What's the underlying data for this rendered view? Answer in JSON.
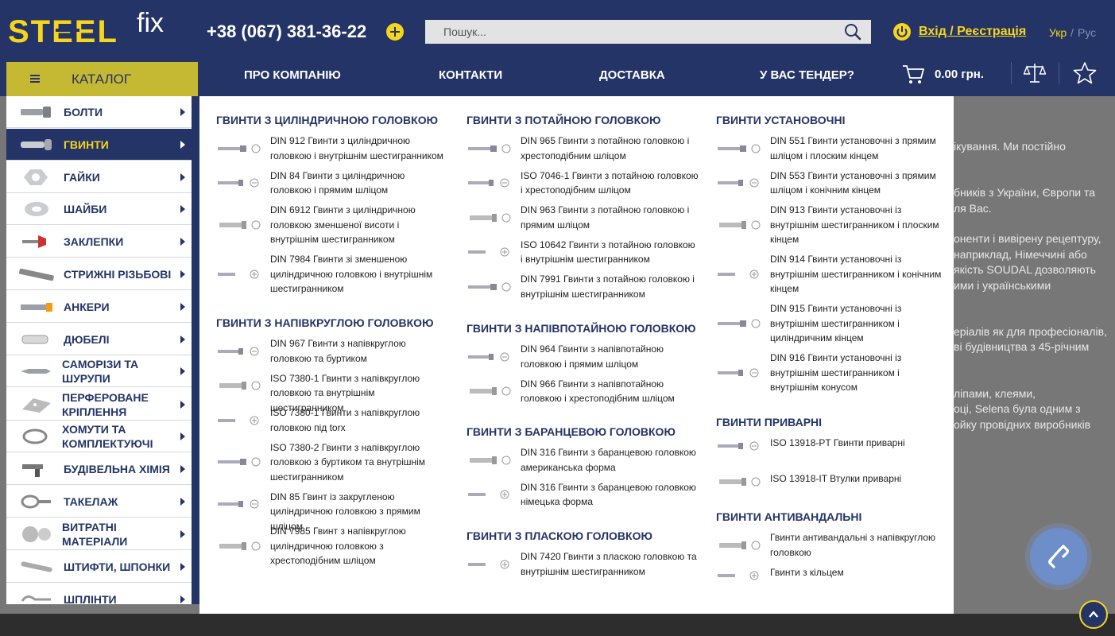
{
  "header": {
    "logo_text": "STEEL",
    "logo_suffix": "fix",
    "phone": "+38 (067) 381-36-22",
    "search_placeholder": "Пошук...",
    "login": "Вхід / Реєстрація",
    "lang_ua": "Укр",
    "lang_sep": "/",
    "lang_ru": "Рус"
  },
  "nav": {
    "catalog": "КАТАЛОГ",
    "items": [
      "ПРО КОМПАНІЮ",
      "КОНТАКТИ",
      "ДОСТАВКА",
      "У ВАС ТЕНДЕР?"
    ],
    "cart_total": "0.00 грн."
  },
  "sidebar": {
    "items": [
      {
        "label": "БОЛТИ",
        "icon": "bolt-icon"
      },
      {
        "label": "ГВИНТИ",
        "icon": "screw-icon",
        "active": true
      },
      {
        "label": "ГАЙКИ",
        "icon": "nut-icon"
      },
      {
        "label": "ШАЙБИ",
        "icon": "washer-icon"
      },
      {
        "label": "ЗАКЛЕПКИ",
        "icon": "rivet-icon"
      },
      {
        "label": "СТРИЖНІ РІЗЬБОВІ",
        "icon": "threaded-rod-icon"
      },
      {
        "label": "АНКЕРИ",
        "icon": "anchor-icon"
      },
      {
        "label": "ДЮБЕЛІ",
        "icon": "dowel-icon"
      },
      {
        "label": "САМОРІЗИ ТА\nШУРУПИ",
        "icon": "self-tapping-screw-icon"
      },
      {
        "label": "ПЕРФЕРОВАНЕ\nКРІПЛЕННЯ",
        "icon": "perforated-fastener-icon"
      },
      {
        "label": "ХОМУТИ ТА\nКОМПЛЕКТУЮЧІ",
        "icon": "clamp-icon"
      },
      {
        "label": "БУДІВЕЛЬНА ХІМІЯ",
        "icon": "sealant-gun-icon"
      },
      {
        "label": "ТАКЕЛАЖ",
        "icon": "rigging-icon"
      },
      {
        "label": "ВИТРАТНІ\nМАТЕРІАЛИ",
        "icon": "abrasive-disc-icon"
      },
      {
        "label": "ШТИФТИ, ШПОНКИ",
        "icon": "pin-icon"
      },
      {
        "label": "ШПЛІНТИ",
        "icon": "cotter-pin-icon"
      }
    ]
  },
  "dropdown": {
    "col1": {
      "sections": [
        {
          "title": "ГВИНТИ З ЦИЛІНДРИЧНОЮ ГОЛОВКОЮ",
          "items": [
            "DIN 912 Гвинти з циліндричною головкою і внутрішнім шестигранником",
            "DIN 84 Гвинти з циліндричною головкою і прямим шліцом",
            "DIN 6912 Гвинти з циліндричною головкою зменшеної висоти і внутрішнім шестигранником",
            "DIN 7984 Гвинти зі зменшеною циліндричною головкою і внутрішнім шестигранником"
          ]
        },
        {
          "title": "ГВИНТИ З НАПІВКРУГЛОЮ ГОЛОВКОЮ",
          "items": [
            "DIN 967 Гвинти з напівкруглою головкою та буртиком",
            "ISO 7380-1 Гвинти з напівкруглою головкою та внутрішнім шестигранником",
            "ISO 7380-1 Гвинти з напівкруглою головкою під torx",
            "ISO 7380-2 Гвинти з напівкруглою головкою з буртиком та внутрішнім шестигранником",
            "DIN 85 Гвинт із закругленою циліндричною головкою з прямим шліцом",
            "DIN 7985 Гвинт з напівкруглою циліндричною головкою з хрестоподібним шліцом"
          ]
        }
      ]
    },
    "col2": {
      "sections": [
        {
          "title": "ГВИНТИ З ПОТАЙНОЮ ГОЛОВКОЮ",
          "items": [
            "DIN 965 Гвинти з потайною головкою і хрестоподібним шліцом",
            "ISO 7046-1 Гвинти з потайною головкою і хрестоподібним шліцом",
            "DIN 963 Гвинти з потайною головкою і прямим шліцом",
            "ISO 10642 Гвинти з потайною головкою і внутрішнім шестигранником",
            "DIN 7991 Гвинти з потайною головкою і внутрішнім шестигранником"
          ]
        },
        {
          "title": "ГВИНТИ З НАПІВПОТАЙНОЮ ГОЛОВКОЮ",
          "items": [
            "DIN 964 Гвинти з напівпотайною головкою і прямим шліцом",
            "DIN 966 Гвинти з напівпотайною головкою і хрестоподібним шліцом"
          ]
        },
        {
          "title": "ГВИНТИ З БАРАНЦЕВОЮ ГОЛОВКОЮ",
          "items": [
            "DIN 316 Гвинти з баранцевою головкою американська форма",
            "DIN 316 Гвинти з баранцевою головкою німецька форма"
          ]
        },
        {
          "title": "ГВИНТИ З ПЛАСКОЮ ГОЛОВКОЮ",
          "items": [
            "DIN 7420 Гвинти з пласкою головкою та внутрішнім шестигранником"
          ]
        }
      ]
    },
    "col3": {
      "sections": [
        {
          "title": "ГВИНТИ УСТАНОВОЧНІ",
          "items": [
            "DIN 551 Гвинти установочні з прямим шліцом і плоским кінцем",
            "DIN 553 Гвинти установочні з прямим шліцом і конічним кінцем",
            "DIN 913 Гвинти установочні із внутрішнім шестигранником і плоским кінцем",
            "DIN 914 Гвинти установочні із внутрішнім шестигранником і конічним кінцем",
            "DIN 915 Гвинти установочні із внутрішнім шестигранником і циліндричним кінцем",
            "DIN 916 Гвинти установочні із внутрішнім шестигранником і внутрішнім конусом"
          ]
        },
        {
          "title": "ГВИНТИ ПРИВАРНІ",
          "items": [
            "ISO 13918-PT Гвинти приварні",
            "ISO 13918-IT Втулки приварні"
          ]
        },
        {
          "title": "ГВИНТИ АНТИВАНДАЛЬНІ",
          "items": [
            "Гвинти антивандальні з напівкруглою головкою",
            "Гвинти з кільцем"
          ]
        }
      ]
    }
  },
  "background_text": [
    "ікування. Ми постійно",
    "бників з України, Європи та",
    "ля Вас.",
    "оненти і вивірену рецептуру,",
    "наприклад, Німеччині або",
    "якість SOUDAL дозволяють",
    "ими і українськими",
    "еріалів як для професіоналів,",
    "ві будівництва з 45-річним",
    "ліпами, клеями,",
    "оці, Selena була одним з",
    "ойку провідних виробників"
  ],
  "colors": {
    "brand_navy": "#243466",
    "brand_yellow": "#f6d51d",
    "catalog_olive": "#c5b832"
  }
}
